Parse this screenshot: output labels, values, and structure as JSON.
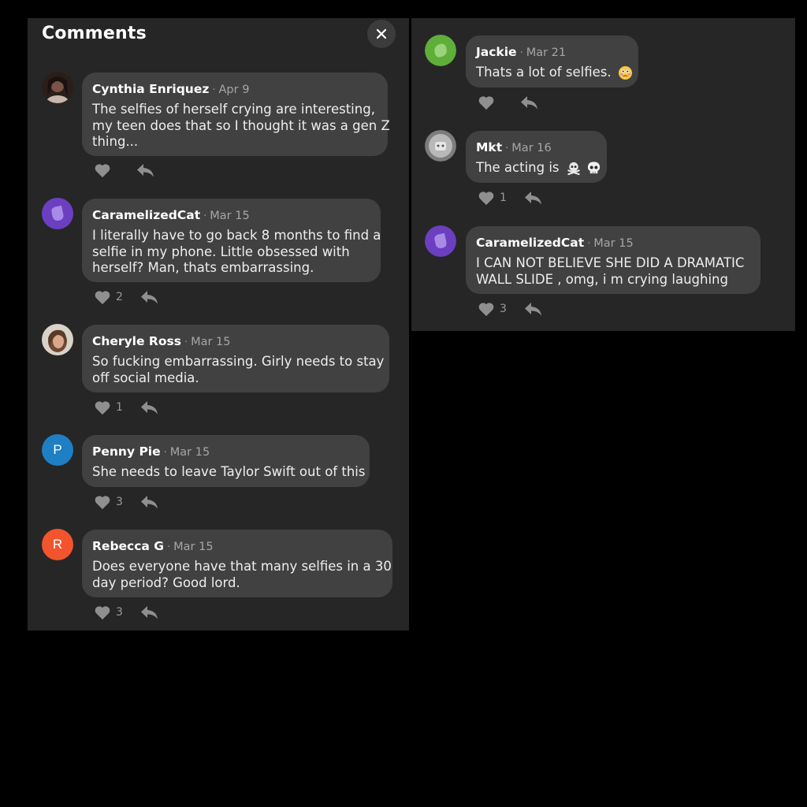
{
  "left_panel": {
    "title": "Comments",
    "close_icon": "close-icon",
    "comments": [
      {
        "author": "Cynthia Enriquez",
        "date": "Apr 9",
        "lines": [
          "The selfies of herself crying are interesting,",
          "my teen does that so I thought it was a gen Z",
          "thing..."
        ],
        "likes": "",
        "avatar": {
          "type": "photo",
          "color": "#5a3e36"
        }
      },
      {
        "author": "CaramelizedCat",
        "date": "Mar 15",
        "lines": [
          "I literally have to go back 8 months to find a",
          "selfie in my phone.  Little obsessed with",
          "herself? Man, thats embarrassing."
        ],
        "likes": "2",
        "avatar": {
          "type": "blob",
          "color": "#6b3fc0"
        }
      },
      {
        "author": "Cheryle Ross",
        "date": "Mar 15",
        "lines": [
          "So fucking embarrassing. Girly needs to stay",
          "off social media."
        ],
        "likes": "1",
        "avatar": {
          "type": "photo",
          "color": "#8a6a55"
        }
      },
      {
        "author": "Penny Pie",
        "date": "Mar 15",
        "lines": [
          "She needs to leave Taylor Swift out of this"
        ],
        "likes": "3",
        "avatar": {
          "type": "letter",
          "letter": "P",
          "color": "#1f7fc4"
        }
      },
      {
        "author": "Rebecca G",
        "date": "Mar 15",
        "lines": [
          "Does everyone have that many selfies in a 30",
          "day period? Good lord."
        ],
        "likes": "3",
        "avatar": {
          "type": "letter",
          "letter": "R",
          "color": "#f2542d"
        }
      }
    ]
  },
  "right_panel": {
    "comments": [
      {
        "author": "Jackie",
        "date": "Mar 21",
        "lines": [
          "Thats a lot of selfies."
        ],
        "emoji": [
          "flushed-face-emoji"
        ],
        "likes": "",
        "avatar": {
          "type": "blob",
          "color": "#5fae3a"
        }
      },
      {
        "author": "Mkt",
        "date": "Mar 16",
        "lines": [
          "The acting is"
        ],
        "emoji": [
          "skull-crossbones-emoji",
          "skull-emoji"
        ],
        "likes": "1",
        "avatar": {
          "type": "photo",
          "color": "#8e8e8e"
        }
      },
      {
        "author": "CaramelizedCat",
        "date": "Mar 15",
        "lines": [
          "I CAN NOT BELIEVE SHE DID A DRAMATIC",
          "WALL SLIDE , omg, i m crying laughing"
        ],
        "likes": "3",
        "avatar": {
          "type": "blob",
          "color": "#6b3fc0"
        }
      }
    ]
  },
  "colors": {
    "background": "#000000",
    "panel": "#262626",
    "bubble": "#414141",
    "icon": "#8f8f8f"
  }
}
